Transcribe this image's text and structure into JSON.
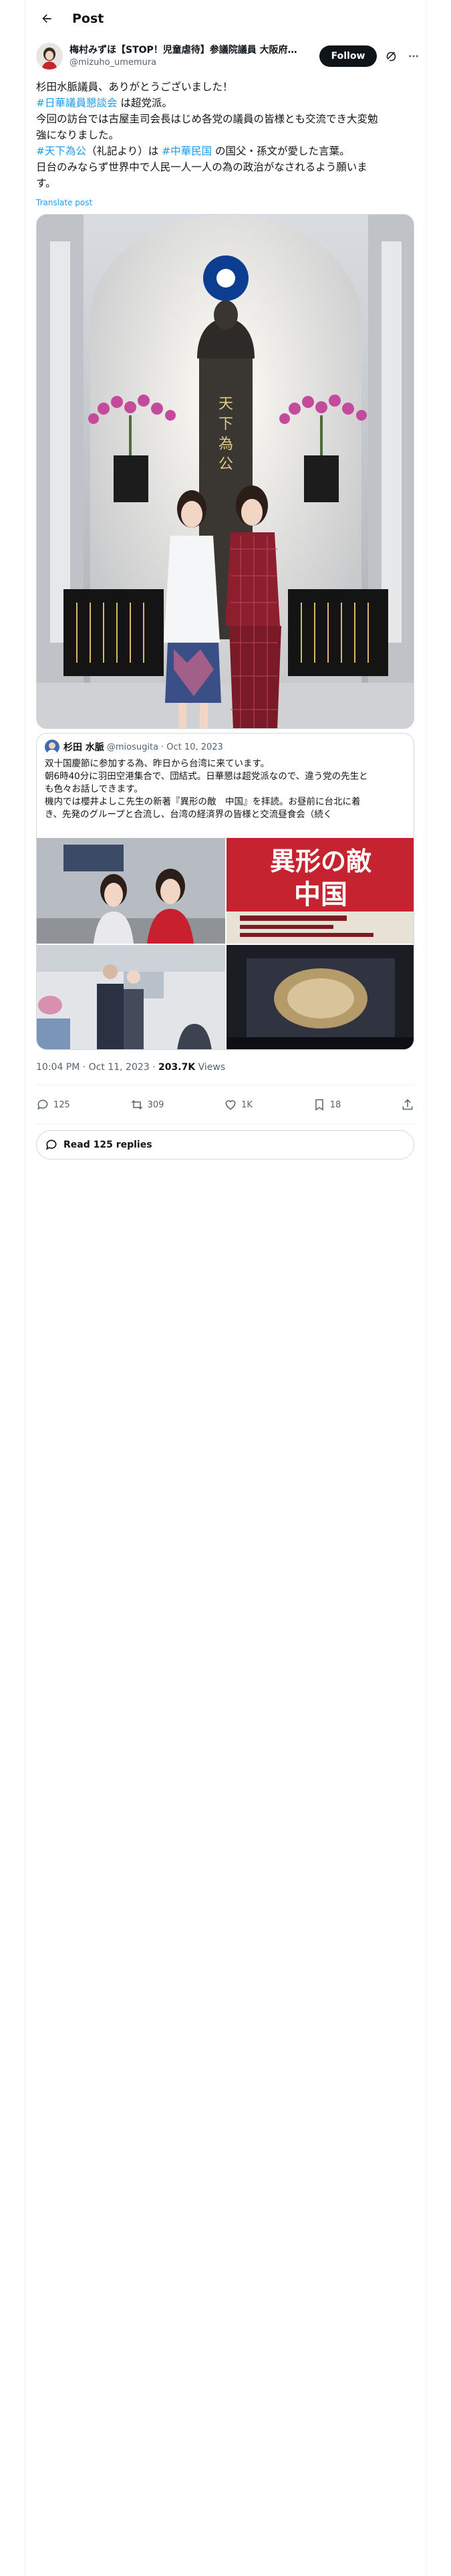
{
  "header": {
    "title": "Post"
  },
  "author": {
    "display_name": "梅村みずほ【STOP！児童虐待】参議院議員 大阪府選…",
    "handle": "@mizuho_umemura",
    "follow_label": "Follow"
  },
  "post": {
    "line1": "杉田水脈議員、ありがとうございました！",
    "line2_tag": "#日華議員懇談会",
    "line2_rest": " は超党派。",
    "line3": "今回の訪台では古屋圭司会長はじめ各党の議員の皆様とも交流でき大変勉",
    "line4": "強になりました。",
    "line5_tag1": "#天下為公",
    "line5_mid": "（礼記より）は ",
    "line5_tag2": "#中華民国",
    "line5_rest": " の国父・孫文が愛した言葉。",
    "line6": "日台のみならず世界中で人民一人一人の為の政治がなされるよう願いま",
    "line7": "す。",
    "translate": "Translate post",
    "photo_calligraphy": "天下為公"
  },
  "quote": {
    "name": "杉田 水脈",
    "handle": "@miosugita",
    "date": "· Oct 10, 2023",
    "line1": "双十国慶節に参加する為、昨日から台湾に来ています。",
    "line2": "朝6時40分に羽田空港集合で、団結式。日華懇は超党派なので、違う党の先生と",
    "line3": "も色々お話しできます。",
    "line4": "機内では櫻井よしこ先生の新著『異形の敵　中国』を拝読。お昼前に台北に着",
    "line5": "き、先発のグループと合流し、台湾の経済界の皆様と交流昼食会（続く",
    "book_title_1": "異形の敵",
    "book_title_2": "中国"
  },
  "timeline": {
    "time": "10:04 PM · Oct 11, 2023 · ",
    "views_count": "203.7K",
    "views_label": " Views"
  },
  "actions": {
    "replies": "125",
    "reposts": "309",
    "likes": "1K",
    "bookmarks": "18"
  },
  "read_replies": "Read 125 replies"
}
